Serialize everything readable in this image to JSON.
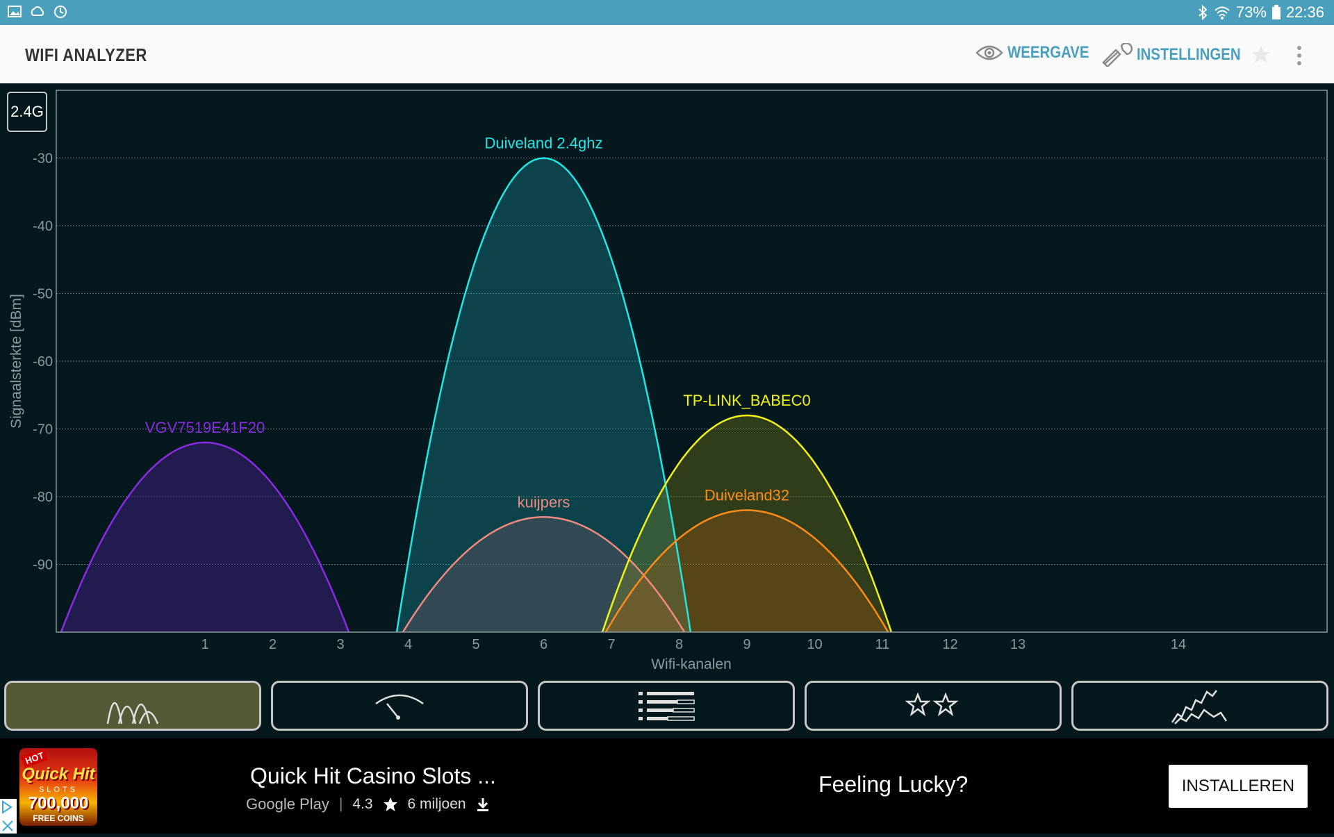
{
  "status_bar": {
    "battery": "73%",
    "time": "22:36"
  },
  "app": {
    "title": "WIFI ANALYZER",
    "view_label": "WEERGAVE",
    "settings_label": "INSTELLINGEN"
  },
  "band": "2.4G",
  "colors": {
    "accent": "#4a9fbd",
    "chart_bg": "#04181e",
    "grid": "#8a9aa0"
  },
  "chart_data": {
    "type": "area",
    "xlabel": "Wifi-kanalen",
    "ylabel": "Signaalsterkte [dBm]",
    "ylim": [
      -100,
      -20
    ],
    "yticks": [
      -30,
      -40,
      -50,
      -60,
      -70,
      -80,
      -90
    ],
    "xticks": [
      1,
      2,
      3,
      4,
      5,
      6,
      7,
      8,
      9,
      10,
      11,
      12,
      13,
      14
    ],
    "grid": "horizontal",
    "series": [
      {
        "name": "VGV7519E41F20",
        "channel": 1,
        "signal": -72,
        "color": "#8a2be2",
        "fill": "rgba(72,30,140,0.45)"
      },
      {
        "name": "Duiveland 2.4ghz",
        "channel": 6,
        "signal": -30,
        "color": "#22e6e6",
        "fill": "rgba(30,150,160,0.35)"
      },
      {
        "name": "kuijpers",
        "channel": 6,
        "signal": -83,
        "color": "#f08a80",
        "fill": "rgba(120,90,100,0.35)"
      },
      {
        "name": "TP-LINK_BABEC0",
        "channel": 9,
        "signal": -68,
        "color": "#f2f21a",
        "fill": "rgba(150,150,20,0.30)"
      },
      {
        "name": "Duiveland32",
        "channel": 9,
        "signal": -82,
        "color": "#ff8c1a",
        "fill": "rgba(160,90,20,0.35)"
      }
    ]
  },
  "nav": [
    {
      "icon": "channel-graph-icon"
    },
    {
      "icon": "channel-rating-icon"
    },
    {
      "icon": "ap-list-icon"
    },
    {
      "icon": "favorites-icon"
    },
    {
      "icon": "time-graph-icon"
    }
  ],
  "ad": {
    "title": "Quick Hit Casino Slots ...",
    "store": "Google Play",
    "rating": "4.3",
    "downloads": "6 miljoen",
    "tagline": "Feeling Lucky?",
    "install_label": "INSTALLEREN",
    "logo_hot": "HOT",
    "logo_name": "Quick Hit",
    "logo_slots": "SLOTS",
    "logo_coins": "700,000",
    "logo_free": "FREE COINS"
  }
}
